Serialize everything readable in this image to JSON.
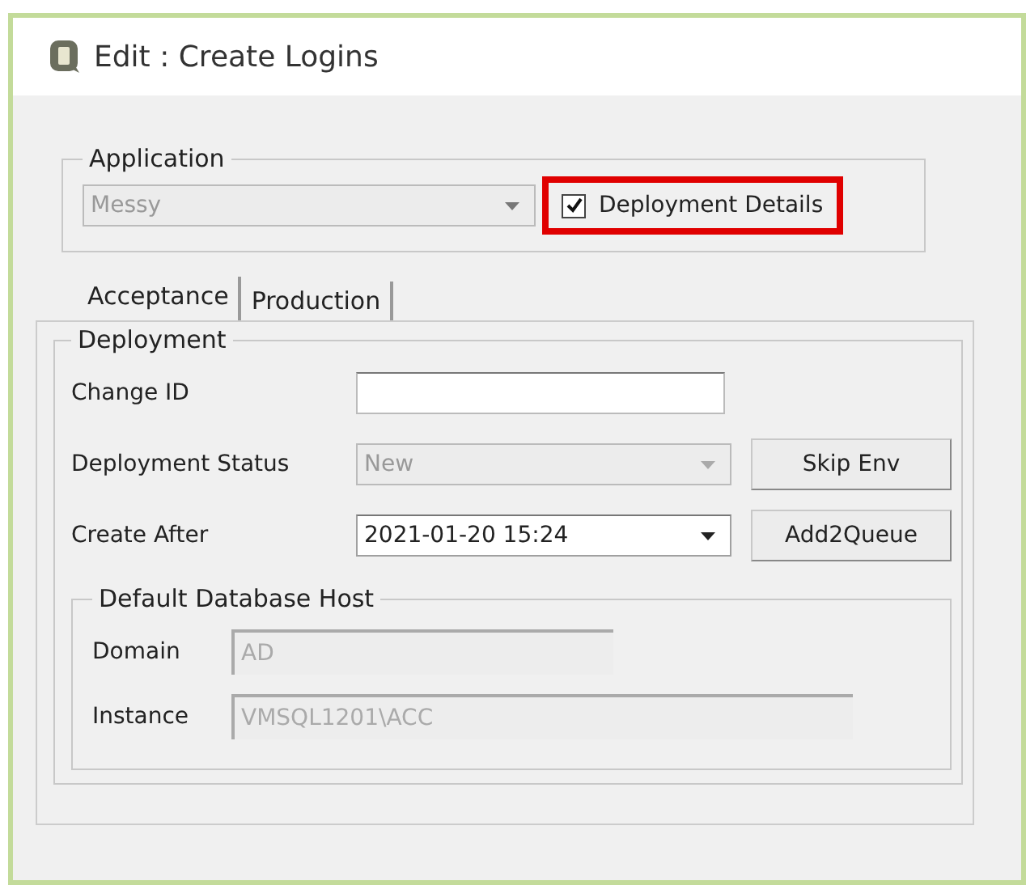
{
  "window": {
    "title": "Edit : Create Logins"
  },
  "application": {
    "label": "Application",
    "value": "Messy",
    "disabled": true,
    "deployment_details": {
      "label": "Deployment Details",
      "checked": true,
      "highlighted": true
    }
  },
  "tabs": [
    {
      "label": "Acceptance",
      "selected": true
    },
    {
      "label": "Production",
      "selected": false
    }
  ],
  "deployment": {
    "label": "Deployment",
    "fields": [
      {
        "kind": "text",
        "label": "Change ID"
      },
      {
        "kind": "combo",
        "label": "Deployment Status",
        "value": "New",
        "disabled": true,
        "button": "Skip Env"
      },
      {
        "kind": "combo",
        "label": "Create After",
        "value": "2021-01-20 15:24",
        "disabled": false,
        "button": "Add2Queue"
      }
    ],
    "database_host": {
      "label": "Default Database Host",
      "fields": [
        {
          "label": "Domain",
          "value": "AD"
        },
        {
          "label": "Instance",
          "value": "VMSQL1201\\ACC"
        }
      ]
    }
  }
}
